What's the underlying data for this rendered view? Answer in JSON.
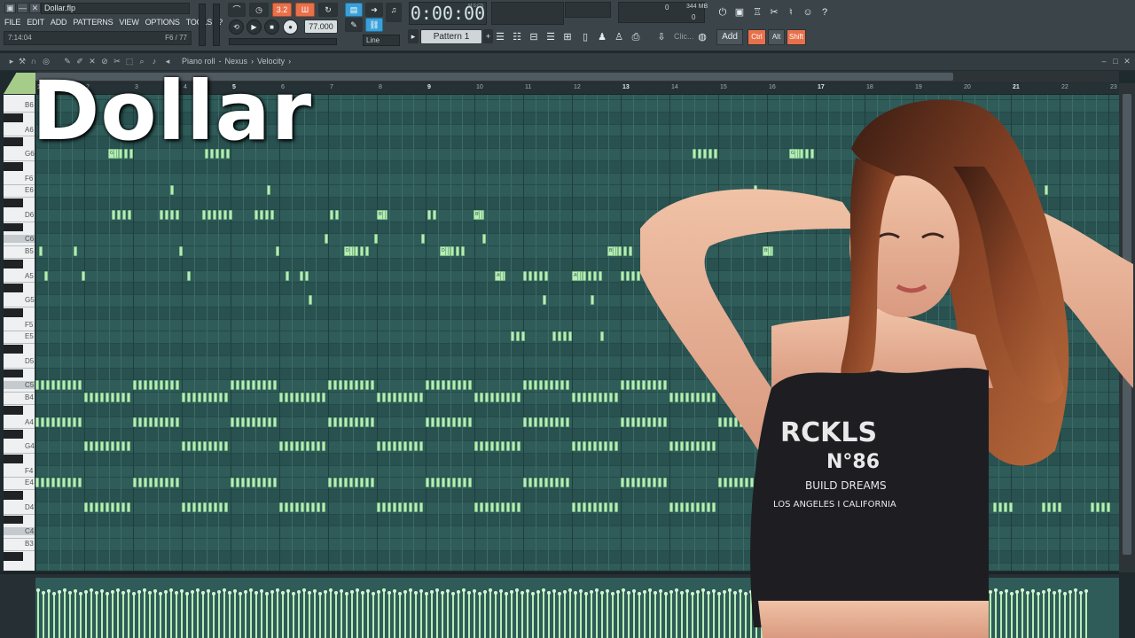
{
  "window": {
    "file_name": "Dollar.flp",
    "buttons": [
      "▣",
      "—",
      "✕"
    ]
  },
  "menu": [
    "FILE",
    "EDIT",
    "ADD",
    "PATTERNS",
    "VIEW",
    "OPTIONS",
    "TOOLS",
    "?"
  ],
  "hint_bar": {
    "left": "7:14:04",
    "right": "F6 / 77"
  },
  "transport": {
    "tempo": "77.000",
    "time": "0:00:00",
    "time_unit": "M:S:CS",
    "pattern": "Pattern 1",
    "snap": "Line",
    "song_position_label": "3.2"
  },
  "monitor": {
    "cpu": "0",
    "memory": "344 MB",
    "polyphony": "0"
  },
  "toolbar_right": {
    "add_label": "Add",
    "hint_text": "Clic..."
  },
  "modifiers": [
    "Ctrl",
    "Alt",
    "Shift"
  ],
  "piano_roll": {
    "crumbs": [
      "Piano roll",
      "-",
      "Nexus",
      "›",
      "Velocity",
      "›"
    ],
    "bar_numbers": [
      "1",
      "2",
      "3",
      "4",
      "5",
      "6",
      "7",
      "8",
      "9",
      "10",
      "11",
      "12",
      "13",
      "14",
      "15",
      "16",
      "17",
      "18",
      "19",
      "20",
      "21",
      "22",
      "23"
    ],
    "key_labels": [
      "B6",
      "A6",
      "G6",
      "F6",
      "E6",
      "D6",
      "C6",
      "B5",
      "A5",
      "G5",
      "F5",
      "E5",
      "D5",
      "C5",
      "B4",
      "A4",
      "G4",
      "F4",
      "E4",
      "D4",
      "C4",
      "B3"
    ],
    "note_labels": [
      "G6",
      "G6",
      "B5",
      "B5",
      "D6",
      "D6",
      "B5",
      "B5",
      "A5",
      "A5",
      "A5"
    ]
  },
  "overlay": {
    "title": "Dollar"
  },
  "colors": {
    "grid": "#2f5b58",
    "note": "#b8ecb6",
    "toolbar": "#3b4449",
    "accent_orange": "#e8704a",
    "accent_blue": "#3aa0d8"
  }
}
